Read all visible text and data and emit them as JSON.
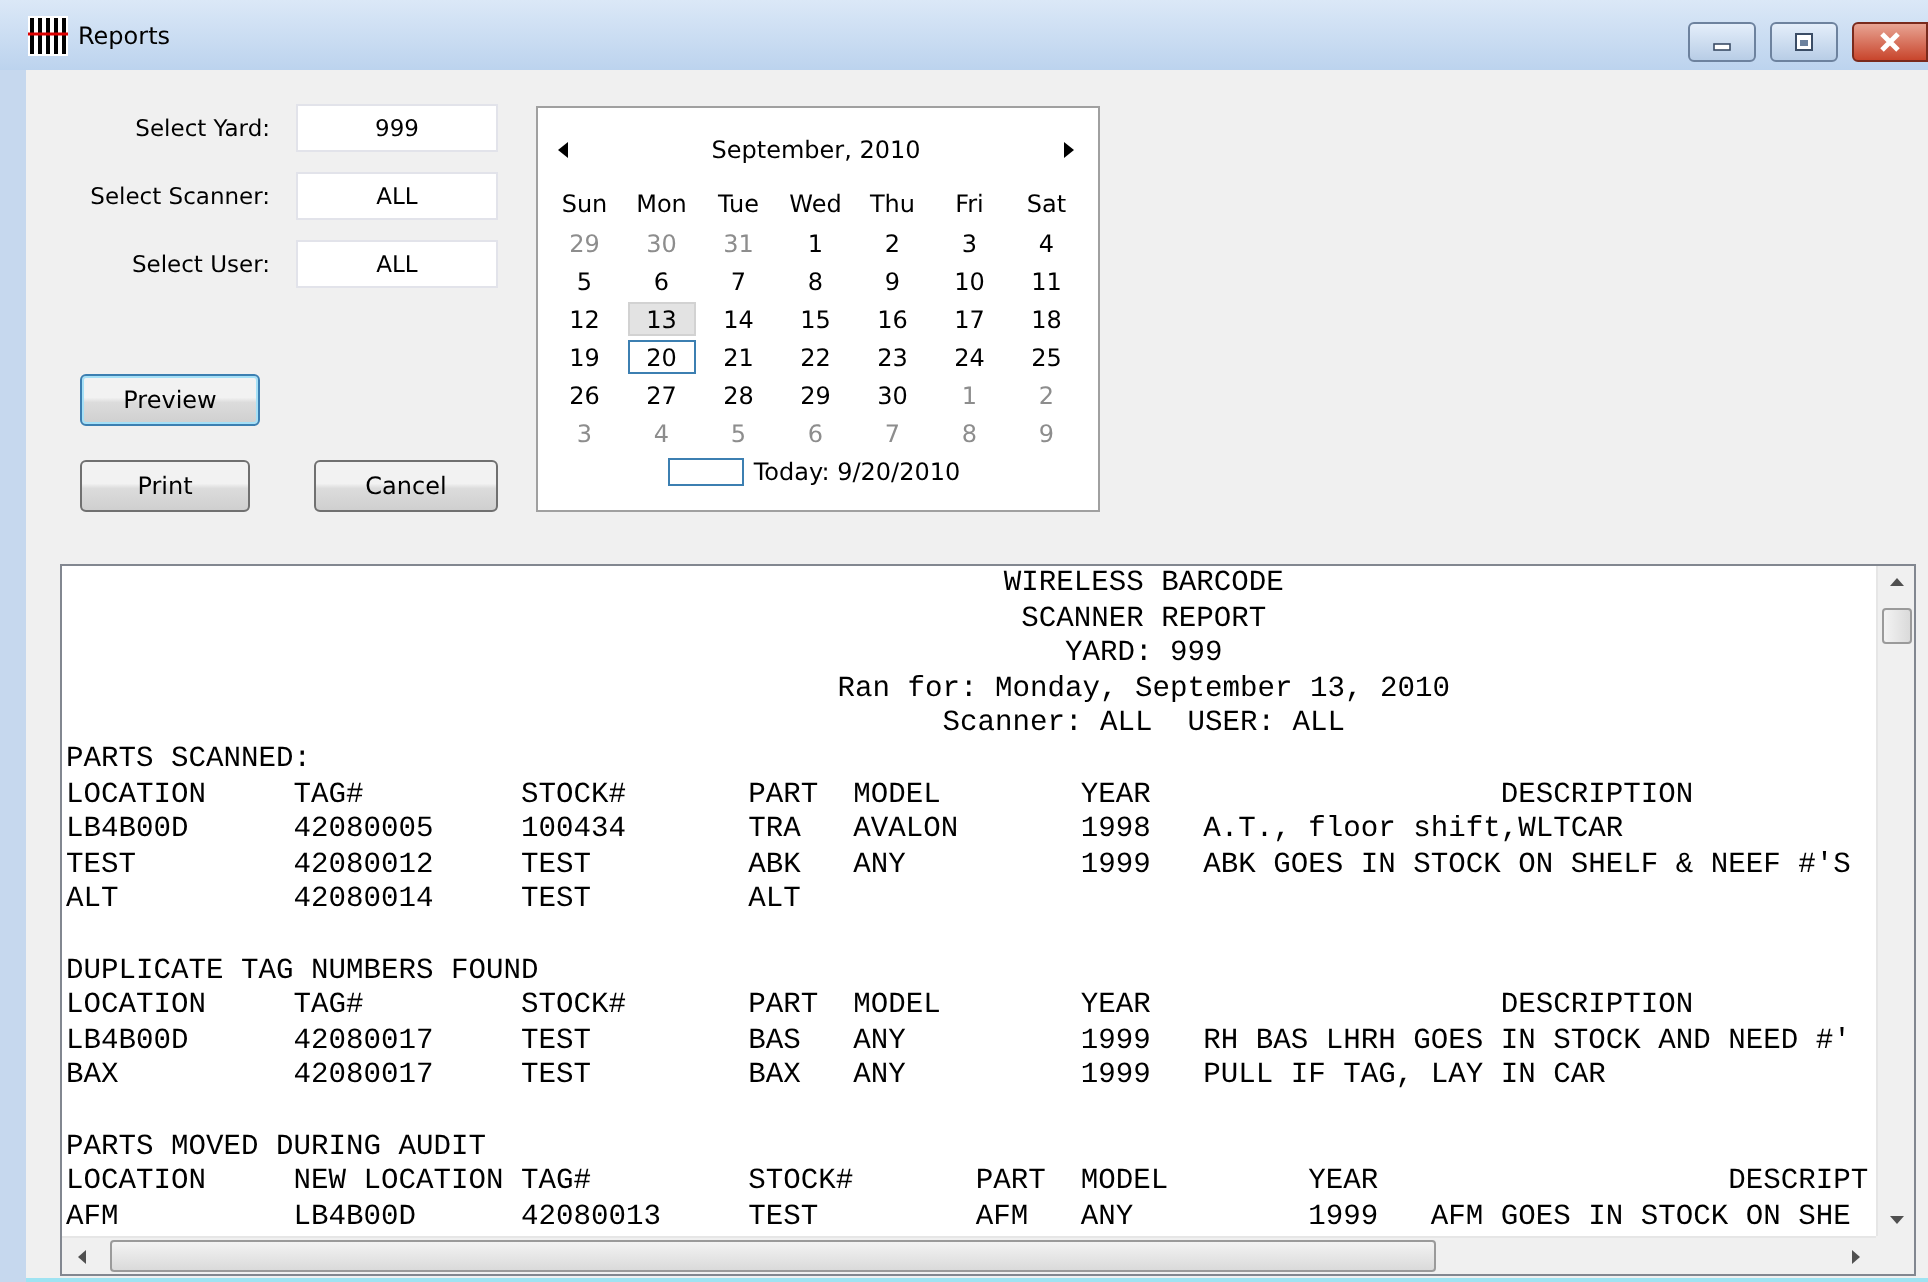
{
  "window": {
    "title": "Reports"
  },
  "form": {
    "fields": [
      {
        "label": "Select Yard:",
        "value": "999"
      },
      {
        "label": "Select Scanner:",
        "value": "ALL"
      },
      {
        "label": "Select User:",
        "value": "ALL"
      }
    ],
    "buttons": [
      {
        "label": "Preview",
        "focused": true
      },
      {
        "label": "Print",
        "focused": false
      },
      {
        "label": "Cancel",
        "focused": false
      }
    ]
  },
  "calendar": {
    "month_title": "September, 2010",
    "weekdays": [
      "Sun",
      "Mon",
      "Tue",
      "Wed",
      "Thu",
      "Fri",
      "Sat"
    ],
    "weeks": [
      [
        {
          "day": "29",
          "other_month": true,
          "selected": false,
          "today": false
        },
        {
          "day": "30",
          "other_month": true,
          "selected": false,
          "today": false
        },
        {
          "day": "31",
          "other_month": true,
          "selected": false,
          "today": false
        },
        {
          "day": "1",
          "other_month": false,
          "selected": false,
          "today": false
        },
        {
          "day": "2",
          "other_month": false,
          "selected": false,
          "today": false
        },
        {
          "day": "3",
          "other_month": false,
          "selected": false,
          "today": false
        },
        {
          "day": "4",
          "other_month": false,
          "selected": false,
          "today": false
        }
      ],
      [
        {
          "day": "5",
          "other_month": false,
          "selected": false,
          "today": false
        },
        {
          "day": "6",
          "other_month": false,
          "selected": false,
          "today": false
        },
        {
          "day": "7",
          "other_month": false,
          "selected": false,
          "today": false
        },
        {
          "day": "8",
          "other_month": false,
          "selected": false,
          "today": false
        },
        {
          "day": "9",
          "other_month": false,
          "selected": false,
          "today": false
        },
        {
          "day": "10",
          "other_month": false,
          "selected": false,
          "today": false
        },
        {
          "day": "11",
          "other_month": false,
          "selected": false,
          "today": false
        }
      ],
      [
        {
          "day": "12",
          "other_month": false,
          "selected": false,
          "today": false
        },
        {
          "day": "13",
          "other_month": false,
          "selected": true,
          "today": false
        },
        {
          "day": "14",
          "other_month": false,
          "selected": false,
          "today": false
        },
        {
          "day": "15",
          "other_month": false,
          "selected": false,
          "today": false
        },
        {
          "day": "16",
          "other_month": false,
          "selected": false,
          "today": false
        },
        {
          "day": "17",
          "other_month": false,
          "selected": false,
          "today": false
        },
        {
          "day": "18",
          "other_month": false,
          "selected": false,
          "today": false
        }
      ],
      [
        {
          "day": "19",
          "other_month": false,
          "selected": false,
          "today": false
        },
        {
          "day": "20",
          "other_month": false,
          "selected": false,
          "today": true
        },
        {
          "day": "21",
          "other_month": false,
          "selected": false,
          "today": false
        },
        {
          "day": "22",
          "other_month": false,
          "selected": false,
          "today": false
        },
        {
          "day": "23",
          "other_month": false,
          "selected": false,
          "today": false
        },
        {
          "day": "24",
          "other_month": false,
          "selected": false,
          "today": false
        },
        {
          "day": "25",
          "other_month": false,
          "selected": false,
          "today": false
        }
      ],
      [
        {
          "day": "26",
          "other_month": false,
          "selected": false,
          "today": false
        },
        {
          "day": "27",
          "other_month": false,
          "selected": false,
          "today": false
        },
        {
          "day": "28",
          "other_month": false,
          "selected": false,
          "today": false
        },
        {
          "day": "29",
          "other_month": false,
          "selected": false,
          "today": false
        },
        {
          "day": "30",
          "other_month": false,
          "selected": false,
          "today": false
        },
        {
          "day": "1",
          "other_month": true,
          "selected": false,
          "today": false
        },
        {
          "day": "2",
          "other_month": true,
          "selected": false,
          "today": false
        }
      ],
      [
        {
          "day": "3",
          "other_month": true,
          "selected": false,
          "today": false
        },
        {
          "day": "4",
          "other_month": true,
          "selected": false,
          "today": false
        },
        {
          "day": "5",
          "other_month": true,
          "selected": false,
          "today": false
        },
        {
          "day": "6",
          "other_month": true,
          "selected": false,
          "today": false
        },
        {
          "day": "7",
          "other_month": true,
          "selected": false,
          "today": false
        },
        {
          "day": "8",
          "other_month": true,
          "selected": false,
          "today": false
        },
        {
          "day": "9",
          "other_month": true,
          "selected": false,
          "today": false
        }
      ]
    ],
    "today_label": "Today: 9/20/2010"
  },
  "report": {
    "lines": [
      {
        "kind": "title",
        "text": "WIRELESS BARCODE"
      },
      {
        "kind": "title",
        "text": "SCANNER REPORT"
      },
      {
        "kind": "title",
        "text": "YARD: 999"
      },
      {
        "kind": "title",
        "text": "Ran for: Monday, September 13, 2010"
      },
      {
        "kind": "title",
        "text": "Scanner: ALL  USER: ALL"
      },
      {
        "kind": "text",
        "text": "PARTS SCANNED:"
      },
      {
        "kind": "text",
        "text": "LOCATION     TAG#         STOCK#       PART  MODEL        YEAR                    DESCRIPTION"
      },
      {
        "kind": "text",
        "text": "LB4B00D      42080005     100434       TRA   AVALON       1998   A.T., floor shift,WLTCAR"
      },
      {
        "kind": "text",
        "text": "TEST         42080012     TEST         ABK   ANY          1999   ABK GOES IN STOCK ON SHELF & NEEF #'S"
      },
      {
        "kind": "text",
        "text": "ALT          42080014     TEST         ALT"
      },
      {
        "kind": "blank"
      },
      {
        "kind": "text",
        "text": "DUPLICATE TAG NUMBERS FOUND"
      },
      {
        "kind": "text",
        "text": "LOCATION     TAG#         STOCK#       PART  MODEL        YEAR                    DESCRIPTION"
      },
      {
        "kind": "text",
        "text": "LB4B00D      42080017     TEST         BAS   ANY          1999   RH BAS LHRH GOES IN STOCK AND NEED #'"
      },
      {
        "kind": "text",
        "text": "BAX          42080017     TEST         BAX   ANY          1999   PULL IF TAG, LAY IN CAR"
      },
      {
        "kind": "blank"
      },
      {
        "kind": "text",
        "text": "PARTS MOVED DURING AUDIT"
      },
      {
        "kind": "text",
        "text": "LOCATION     NEW LOCATION TAG#         STOCK#       PART  MODEL        YEAR                    DESCRIPT"
      },
      {
        "kind": "text",
        "text": "AFM          LB4B00D      42080013     TEST         AFM   ANY          1999   AFM GOES IN STOCK ON SHE"
      }
    ]
  }
}
